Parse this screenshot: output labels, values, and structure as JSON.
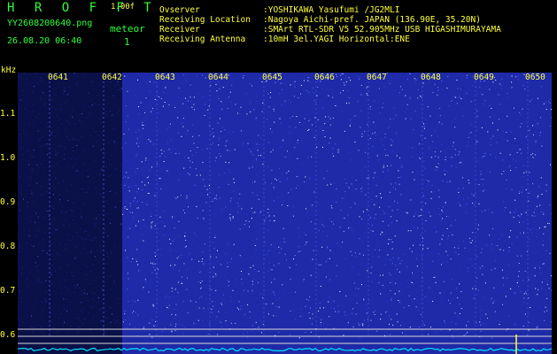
{
  "header": {
    "app_title": "H R O F F T",
    "app_version": "1.00f",
    "filename": "YY2608200640.png",
    "datetime": "26.08.20 06:40",
    "meteor_label": "meteor",
    "meteor_count": "1"
  },
  "metadata": [
    {
      "key": "Ovserver",
      "value": ":YOSHIKAWA Yasufumi /JG2MLI"
    },
    {
      "key": "Receiving Location",
      "value": ":Nagoya Aichi-pref. JAPAN (136.90E, 35.20N)"
    },
    {
      "key": "Receiver",
      "value": ":SMArt RTL-SDR V5 52.905MHz USB HIGASHIMURAYAMA"
    },
    {
      "key": "Receiving Antenna",
      "value": ":10mH 3el.YAGI Horizontal:ENE"
    }
  ],
  "axes": {
    "y_unit": "kHz",
    "y_ticks": [
      "1.1",
      "1.0",
      "0.9",
      "0.8",
      "0.7",
      "0.6"
    ],
    "x_ticks": [
      "0641",
      "0642",
      "0643",
      "0644",
      "0645",
      "0646",
      "0647",
      "0648",
      "0649",
      "0650"
    ]
  },
  "colors": {
    "background": "#000000",
    "label_green": "#2cff3a",
    "label_yellow": "#ffff3a",
    "waterfall_noise": "#1e2aa8",
    "waterfall_dark": "#0a1048",
    "spectrum_line": "#00e5ff"
  }
}
